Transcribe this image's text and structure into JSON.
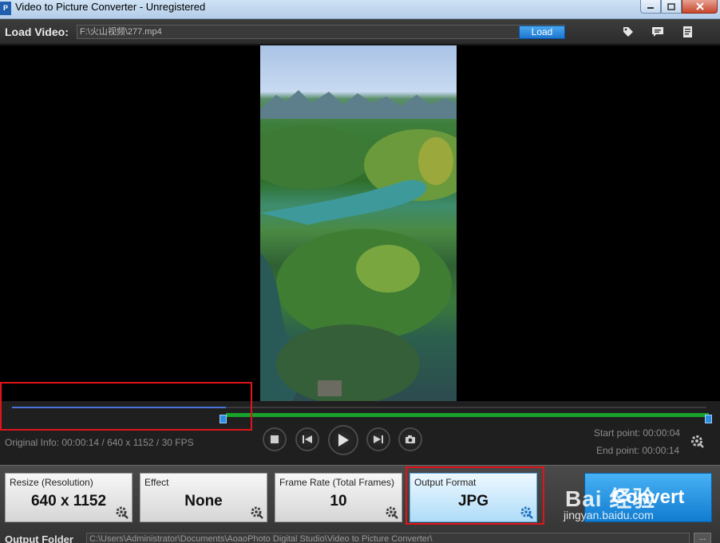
{
  "window": {
    "title": "Video to Picture Converter - Unregistered",
    "app_icon_text": "P"
  },
  "toolbar": {
    "load_video_label": "Load Video:",
    "video_path": "F:\\火山视频\\277.mp4",
    "load_button": "Load",
    "icons": [
      "tag-icon",
      "comment-icon",
      "notes-icon"
    ]
  },
  "video": {
    "original_info": "Original Info: 00:00:14 / 640 x 1152 / 30 FPS",
    "start_point": "Start point: 00:00:04",
    "end_point": "End point: 00:00:14",
    "progress_fraction": 0.31,
    "selection_start_fraction": 0.31,
    "selection_end_fraction": 1.0
  },
  "settings": {
    "resize": {
      "label": "Resize (Resolution)",
      "value": "640 x 1152"
    },
    "effect": {
      "label": "Effect",
      "value": "None"
    },
    "frame_rate": {
      "label": "Frame Rate (Total Frames)",
      "value": "10"
    },
    "output_format": {
      "label": "Output Format",
      "value": "JPG"
    },
    "convert_button": "Convert"
  },
  "output": {
    "label": "Output Folder",
    "path": "C:\\Users\\Administrator\\Documents\\AoaoPhoto Digital Studio\\Video to Picture Converter\\",
    "browse_label": "..."
  },
  "watermark": {
    "text": "Bai 经验",
    "url": "jingyan.baidu.com"
  },
  "colors": {
    "accent_blue": "#1c77cf",
    "timeline_green": "#18a22b",
    "timeline_blue": "#4a74d9",
    "highlight_red": "#e0141a"
  }
}
